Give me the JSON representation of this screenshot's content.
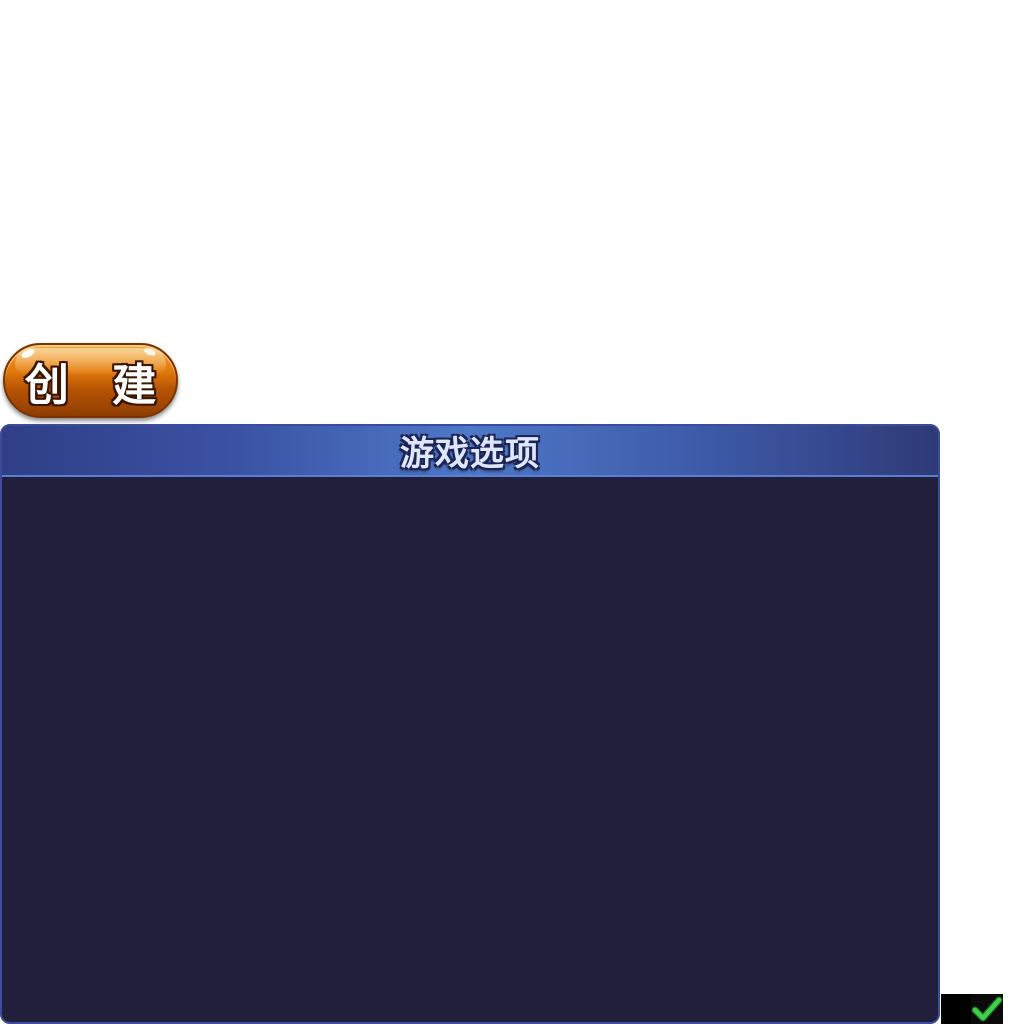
{
  "create_button": {
    "label": "创 建"
  },
  "options_panel": {
    "title": "游戏选项"
  },
  "checkbox": {
    "checked": true,
    "icon": "checkmark-icon",
    "check_color": "#3fcf4a"
  },
  "colors": {
    "button_orange": "#e0780a",
    "panel_background": "#221f3d",
    "panel_header": "#4e78c8"
  }
}
